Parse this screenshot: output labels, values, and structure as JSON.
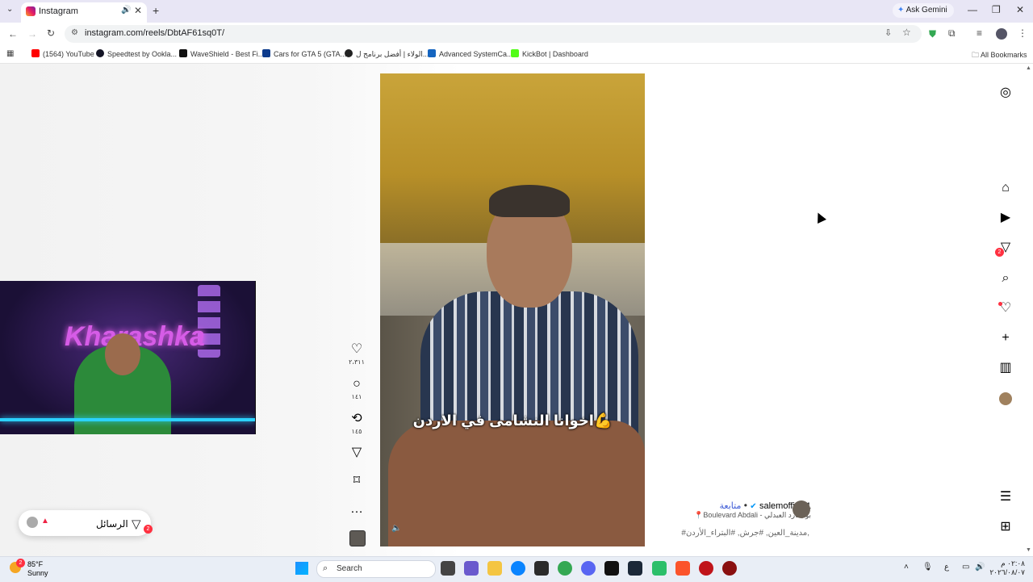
{
  "browser": {
    "tab_title": "Instagram",
    "new_tab": "+",
    "ask_gemini": "Ask Gemini",
    "url": "instagram.com/reels/DbtAF61sq0T/",
    "bookmarks": [
      {
        "label": "(1564) YouTube",
        "color": "#ff0000"
      },
      {
        "label": "Speedtest by Ookla...",
        "color": "#141526"
      },
      {
        "label": "WaveShield - Best Fi...",
        "color": "#111111"
      },
      {
        "label": "Cars for GTA 5 (GTA...",
        "color": "#0d3b8c"
      },
      {
        "label": "الولاء | أفضل برنامج ل...",
        "color": "#222222"
      },
      {
        "label": "Advanced SystemCa...",
        "color": "#1565c0"
      },
      {
        "label": "KickBot | Dashboard",
        "color": "#53fc18"
      }
    ],
    "all_bookmarks": "All Bookmarks"
  },
  "reel": {
    "caption": "اخوانا النشامى في الاردن💪",
    "actions": {
      "likes": "٢،٣١١",
      "comments": "١٤١",
      "reposts": "١٤٥"
    },
    "author": {
      "username": "salemoffical1",
      "follow_label": "متابعة",
      "separator": "•",
      "location": "Boulevard Abdali - بوليفارد العبدلي"
    },
    "hashtags": "#مدينة_العين, #جرش, #البتراء_الأردن,"
  },
  "nav": {
    "messages_badge": "2"
  },
  "messages_pill": {
    "label": "الرسائل",
    "badge": "2"
  },
  "webcam": {
    "logo_text": "Kharashka"
  },
  "taskbar": {
    "weather_temp": "85°F",
    "weather_cond": "Sunny",
    "weather_badge": "2",
    "search_label": "Search",
    "lang": "ع",
    "time": "٠٢:٠٨ م",
    "date": "٢٠٢٦/٠٨/٠٧"
  }
}
